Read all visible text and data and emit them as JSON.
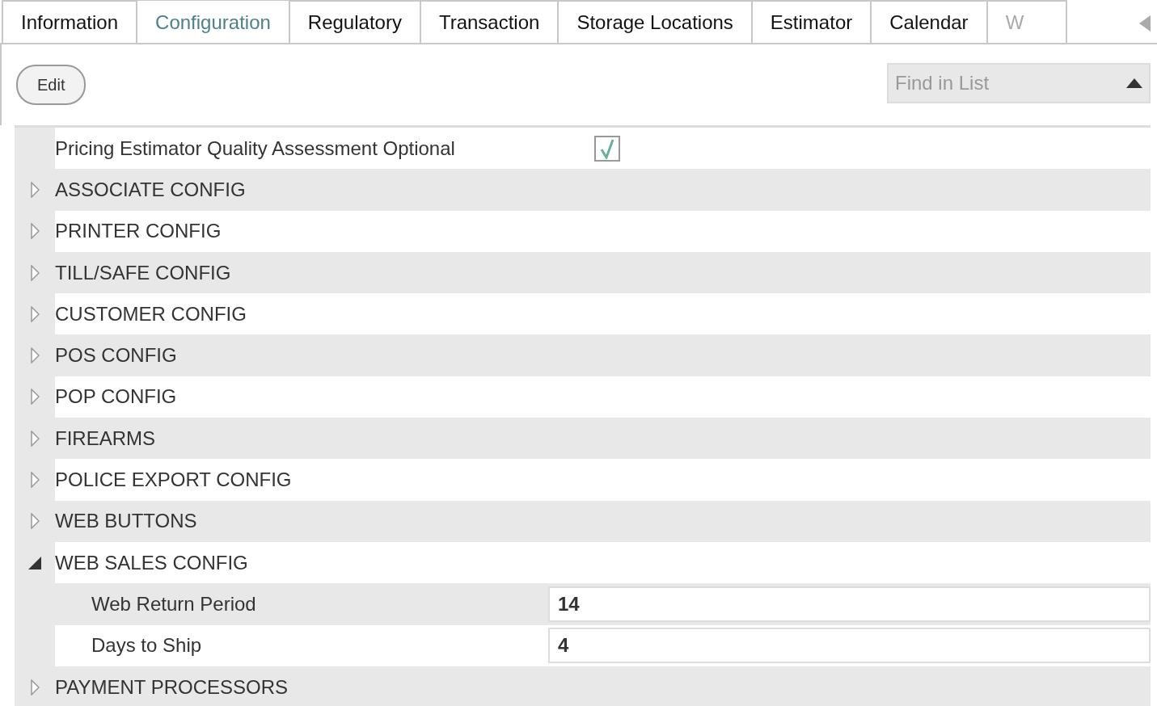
{
  "tabs": [
    {
      "label": "Information",
      "selected": false
    },
    {
      "label": "Configuration",
      "selected": true
    },
    {
      "label": "Regulatory",
      "selected": false
    },
    {
      "label": "Transaction",
      "selected": false
    },
    {
      "label": "Storage Locations",
      "selected": false
    },
    {
      "label": "Estimator",
      "selected": false
    },
    {
      "label": "Calendar",
      "selected": false
    },
    {
      "label": "W",
      "selected": false
    }
  ],
  "edit_button": "Edit",
  "search": {
    "placeholder": "Find in List"
  },
  "rows": [
    {
      "kind": "checkbox",
      "label": "Pricing Estimator Quality Assessment Optional",
      "checked": true
    },
    {
      "kind": "group",
      "label": "ASSOCIATE CONFIG",
      "expanded": false
    },
    {
      "kind": "group",
      "label": "PRINTER CONFIG",
      "expanded": false
    },
    {
      "kind": "group",
      "label": "TILL/SAFE CONFIG",
      "expanded": false
    },
    {
      "kind": "group",
      "label": "CUSTOMER CONFIG",
      "expanded": false
    },
    {
      "kind": "group",
      "label": "POS CONFIG",
      "expanded": false
    },
    {
      "kind": "group",
      "label": "POP CONFIG",
      "expanded": false
    },
    {
      "kind": "group",
      "label": "FIREARMS",
      "expanded": false
    },
    {
      "kind": "group",
      "label": "POLICE EXPORT CONFIG",
      "expanded": false
    },
    {
      "kind": "group",
      "label": "WEB BUTTONS",
      "expanded": false
    },
    {
      "kind": "group",
      "label": "WEB SALES CONFIG",
      "expanded": true,
      "children": [
        {
          "kind": "field",
          "label": "Web Return Period",
          "value": "14"
        },
        {
          "kind": "field",
          "label": "Days to Ship",
          "value": "4"
        }
      ]
    },
    {
      "kind": "group",
      "label": "PAYMENT PROCESSORS",
      "expanded": false
    }
  ]
}
